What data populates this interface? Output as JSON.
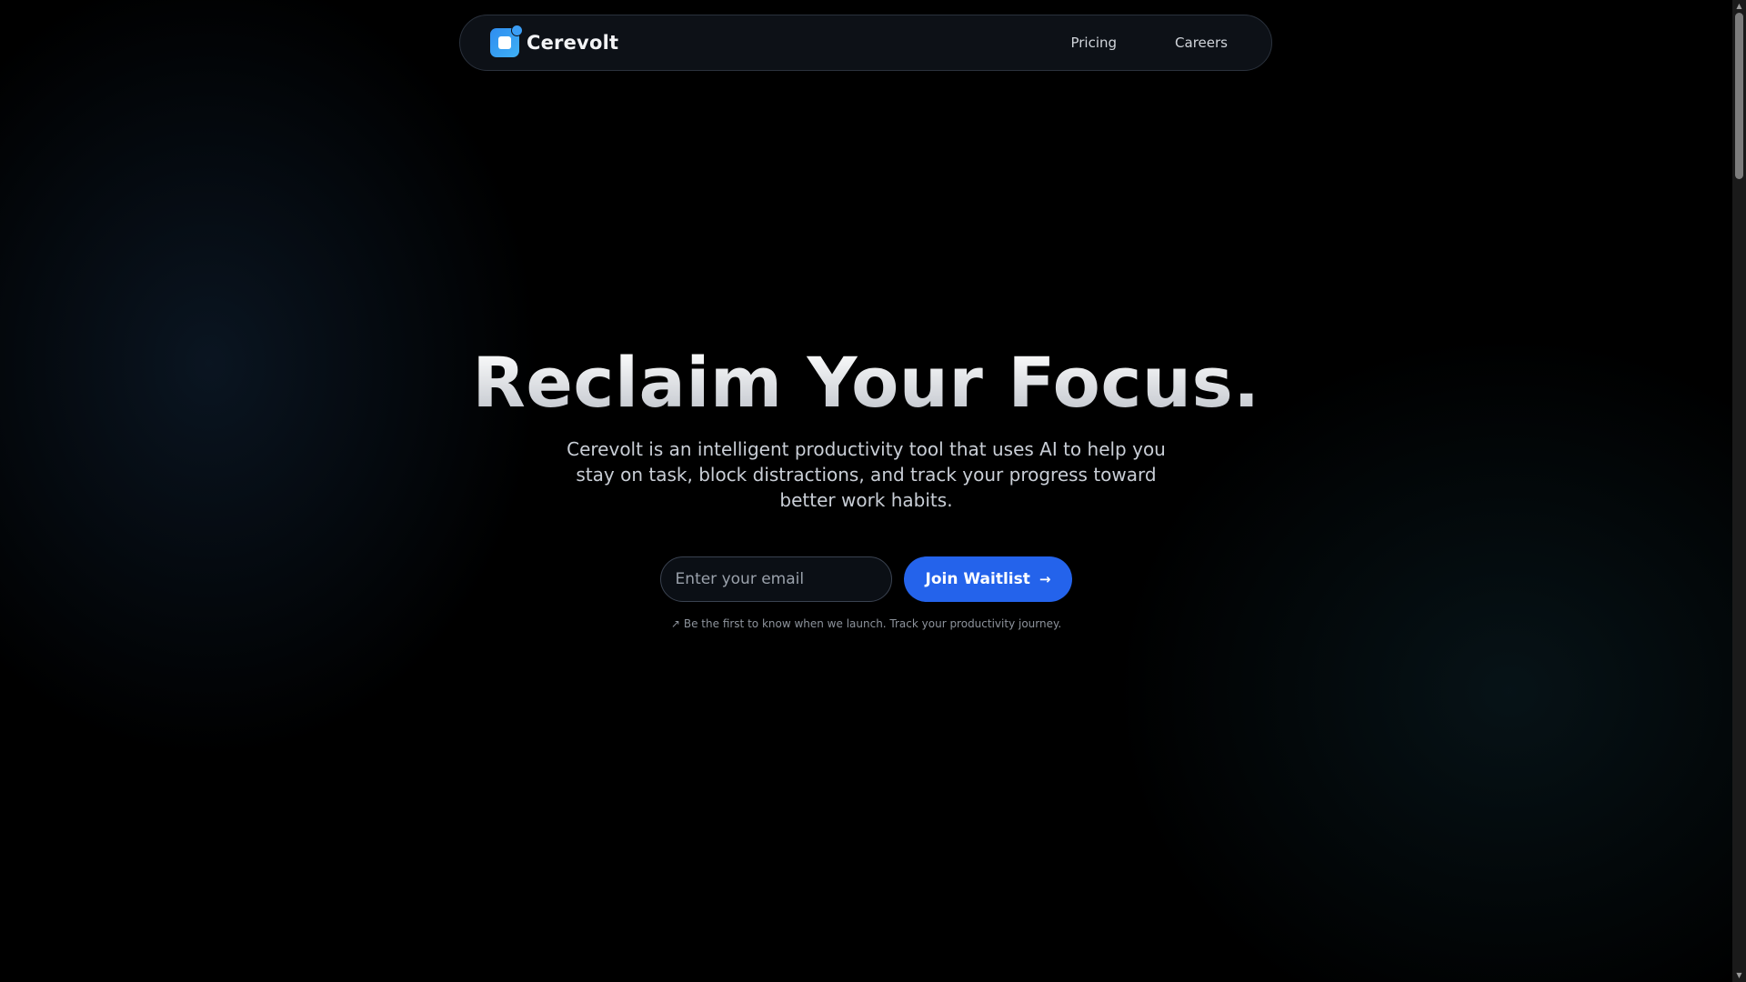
{
  "nav": {
    "brand": "Cerevolt",
    "links": [
      {
        "label": "Pricing"
      },
      {
        "label": "Careers"
      }
    ]
  },
  "hero": {
    "headline": "Reclaim Your Focus.",
    "subtext": "Cerevolt is an intelligent productivity tool that uses AI to help you stay on task, block distractions, and track your progress toward better work habits.",
    "email_placeholder": "Enter your email",
    "email_value": "",
    "cta_label": "Join Waitlist",
    "note": "Be the first to know when we launch. Track your productivity journey."
  },
  "icons": {
    "logo": "cerevolt-logo-icon",
    "cta_arrow": "arrow-right-icon",
    "note_icon": "trending-up-icon"
  },
  "colors": {
    "accent": "#2463eb",
    "logo_gradient_start": "#2f8df0",
    "logo_gradient_end": "#3fb0f5",
    "background": "#000000"
  }
}
